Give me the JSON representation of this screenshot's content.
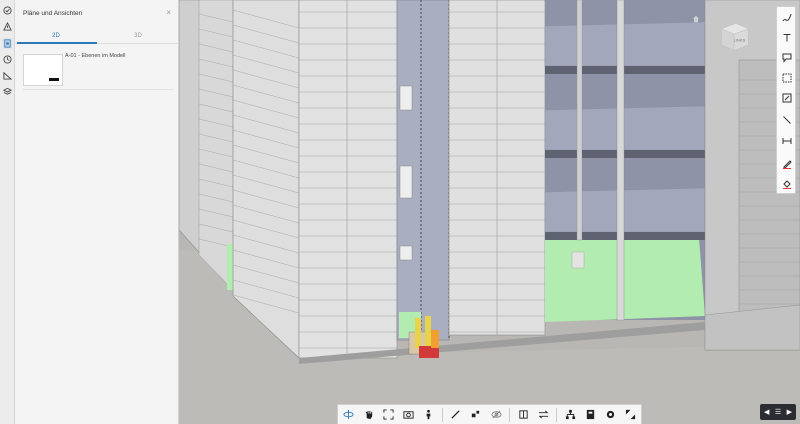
{
  "panel": {
    "title": "Pläne und Ansichten",
    "close_glyph": "×",
    "tabs": [
      {
        "label": "2D",
        "active": true
      },
      {
        "label": "3D",
        "active": false
      }
    ],
    "sheets": [
      {
        "label": "A-01 - Ebenen im Modell"
      }
    ]
  },
  "rail_icons": [
    "recent-icon",
    "warning-icon",
    "sheets-icon",
    "clock-icon",
    "measure-icon",
    "layers-icon"
  ],
  "right_tools": [
    "freehand-icon",
    "text-icon",
    "callout-icon",
    "rectangle-select-icon",
    "polygon-area-icon",
    "line-icon",
    "dimension-icon",
    "pen-icon",
    "fill-icon"
  ],
  "bottom_tools": [
    "orbit-icon",
    "pan-icon",
    "fit-icon",
    "camera-icon",
    "person-icon",
    "measure-icon",
    "explode-icon",
    "ghost-icon",
    "section-icon",
    "compare-icon",
    "model-tree-icon",
    "properties-icon",
    "settings-icon",
    "fullscreen-icon"
  ],
  "view_cube": {
    "face_label": "LINKS"
  },
  "pager": {
    "glyph_prev": "◀",
    "glyph_menu": "☰",
    "glyph_next": "▶"
  },
  "colors": {
    "accent": "#2a7ab8",
    "highlight_green": "#b3ecb0",
    "facade": "#dcdcdc",
    "panel_bg": "#f4f4f4"
  }
}
